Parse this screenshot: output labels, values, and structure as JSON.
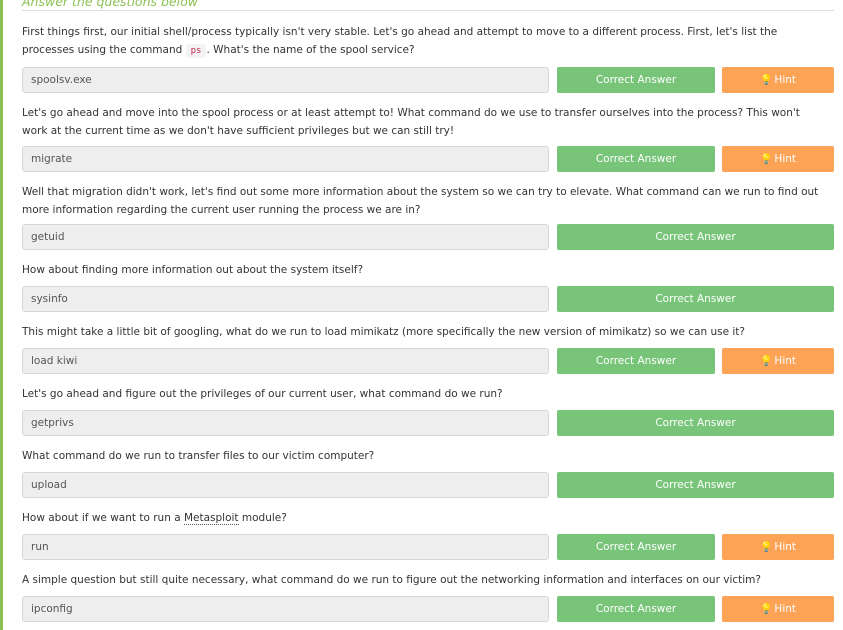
{
  "header": {
    "title": "Answer the questions below"
  },
  "colors": {
    "accent": "#8cc152",
    "correct": "#78c57a",
    "hint": "#fda356",
    "code": "#c7254e"
  },
  "questions": [
    {
      "text_before": "First things first, our initial shell/process typically isn't very stable. Let's go ahead and attempt to move to a different process. First, let's list the processes using the command ",
      "code": "ps",
      "text_after": ". What's the name of the spool service?",
      "answer": "spoolsv.exe",
      "correct_label": "Correct Answer",
      "hint_label": "Hint"
    },
    {
      "text": "Let's go ahead and move into the spool process or at least attempt to! What command do we use to transfer ourselves into the process? This won't work at the current time as we don't have sufficient privileges but we can still try!",
      "answer": "migrate",
      "correct_label": "Correct Answer",
      "hint_label": "Hint"
    },
    {
      "text": "Well that migration didn't work, let's find out some more information about the system so we can try to elevate. What command can we run to find out more information regarding the current user running the process we are in?",
      "answer": "getuid",
      "correct_label": "Correct Answer"
    },
    {
      "text": "How about finding more information out about the system itself?",
      "answer": "sysinfo",
      "correct_label": "Correct Answer"
    },
    {
      "text": "This might take a little bit of googling, what do we run to load mimikatz (more specifically the new version of mimikatz) so we can use it?",
      "answer": "load kiwi",
      "correct_label": "Correct Answer",
      "hint_label": "Hint"
    },
    {
      "text": "Let's go ahead and figure out the privileges of our current user, what command do we run?",
      "answer": "getprivs",
      "correct_label": "Correct Answer"
    },
    {
      "text": "What command do we run to transfer files to our victim computer?",
      "answer": "upload",
      "correct_label": "Correct Answer"
    },
    {
      "text_before": "How about if we want to run a ",
      "term": "Metasploit",
      "text_after": " module?",
      "answer": "run",
      "correct_label": "Correct Answer",
      "hint_label": "Hint"
    },
    {
      "text": "A simple question but still quite necessary, what command do we run to figure out the networking information and interfaces on our victim?",
      "answer": "ipconfig",
      "correct_label": "Correct Answer",
      "hint_label": "Hint"
    }
  ]
}
